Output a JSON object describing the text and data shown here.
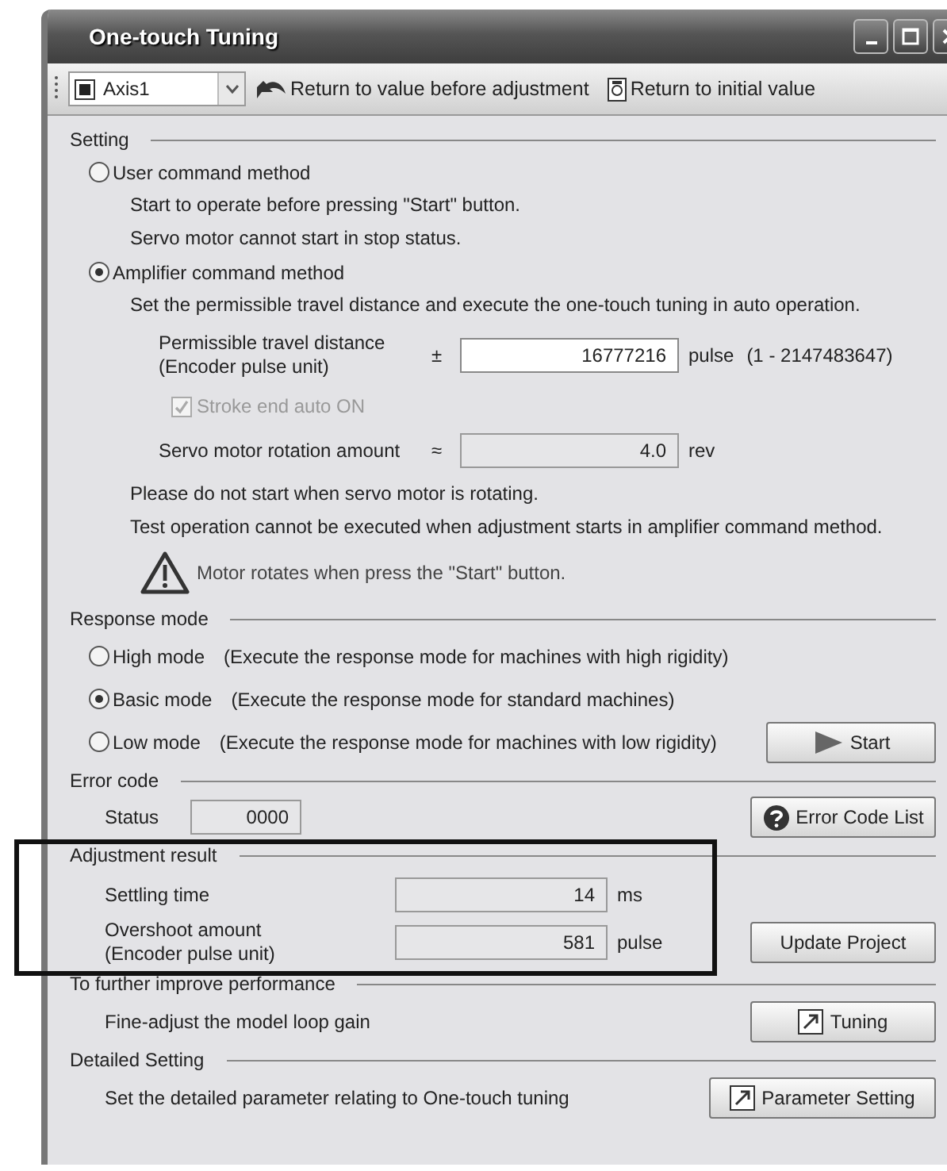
{
  "window": {
    "title": "One-touch Tuning"
  },
  "toolbar": {
    "axis_select": {
      "value": "Axis1"
    },
    "buttons": [
      {
        "kind": "undo",
        "label": "Return to value before adjustment"
      },
      {
        "kind": "reset",
        "label": "Return to initial value"
      }
    ]
  },
  "setting": {
    "title": "Setting",
    "user_command": {
      "label": "User command method",
      "selected": false,
      "notes": [
        "Start to operate before pressing \"Start\" button.",
        "Servo motor cannot start in stop status."
      ]
    },
    "amplifier_command": {
      "label": "Amplifier command method",
      "selected": true,
      "description": "Set the permissible travel distance and execute the one-touch tuning in auto operation.",
      "travel_distance": {
        "label_lines": [
          "Permissible travel distance",
          "(Encoder pulse unit)"
        ],
        "sign": "±",
        "value": "16777216",
        "unit": "pulse",
        "range": "(1 - 2147483647)"
      },
      "stroke_end": {
        "label": "Stroke end auto ON",
        "checked": true,
        "disabled": true
      },
      "rotation": {
        "label": "Servo motor rotation amount",
        "sign": "≈",
        "value": "4.0",
        "unit": "rev"
      },
      "notes": [
        "Please do not start when servo motor is rotating.",
        "Test operation cannot be executed when adjustment starts in amplifier command method."
      ],
      "warning": "Motor rotates when press the \"Start\" button."
    }
  },
  "response_mode": {
    "title": "Response mode",
    "options": [
      {
        "label": "High mode",
        "description": "(Execute the response mode for machines with high rigidity)",
        "selected": false
      },
      {
        "label": "Basic mode",
        "description": "(Execute the response mode for standard machines)",
        "selected": true
      },
      {
        "label": "Low mode",
        "description": "(Execute the response mode for machines with low rigidity)",
        "selected": false
      }
    ],
    "start_button": "Start"
  },
  "error_code": {
    "title": "Error code",
    "status_label": "Status",
    "status_value": "0000",
    "list_button": "Error Code List"
  },
  "adjustment_result": {
    "title": "Adjustment result",
    "settling_label": "Settling time",
    "settling_value": "14",
    "settling_unit": "ms",
    "overshoot_label_lines": [
      "Overshoot amount",
      "(Encoder pulse unit)"
    ],
    "overshoot_value": "581",
    "overshoot_unit": "pulse",
    "update_button": "Update Project"
  },
  "improve": {
    "title": "To further improve performance",
    "description": "Fine-adjust the model loop gain",
    "button": "Tuning"
  },
  "detailed": {
    "title": "Detailed Setting",
    "description": "Set the detailed parameter relating to One-touch tuning",
    "button": "Parameter Setting"
  }
}
